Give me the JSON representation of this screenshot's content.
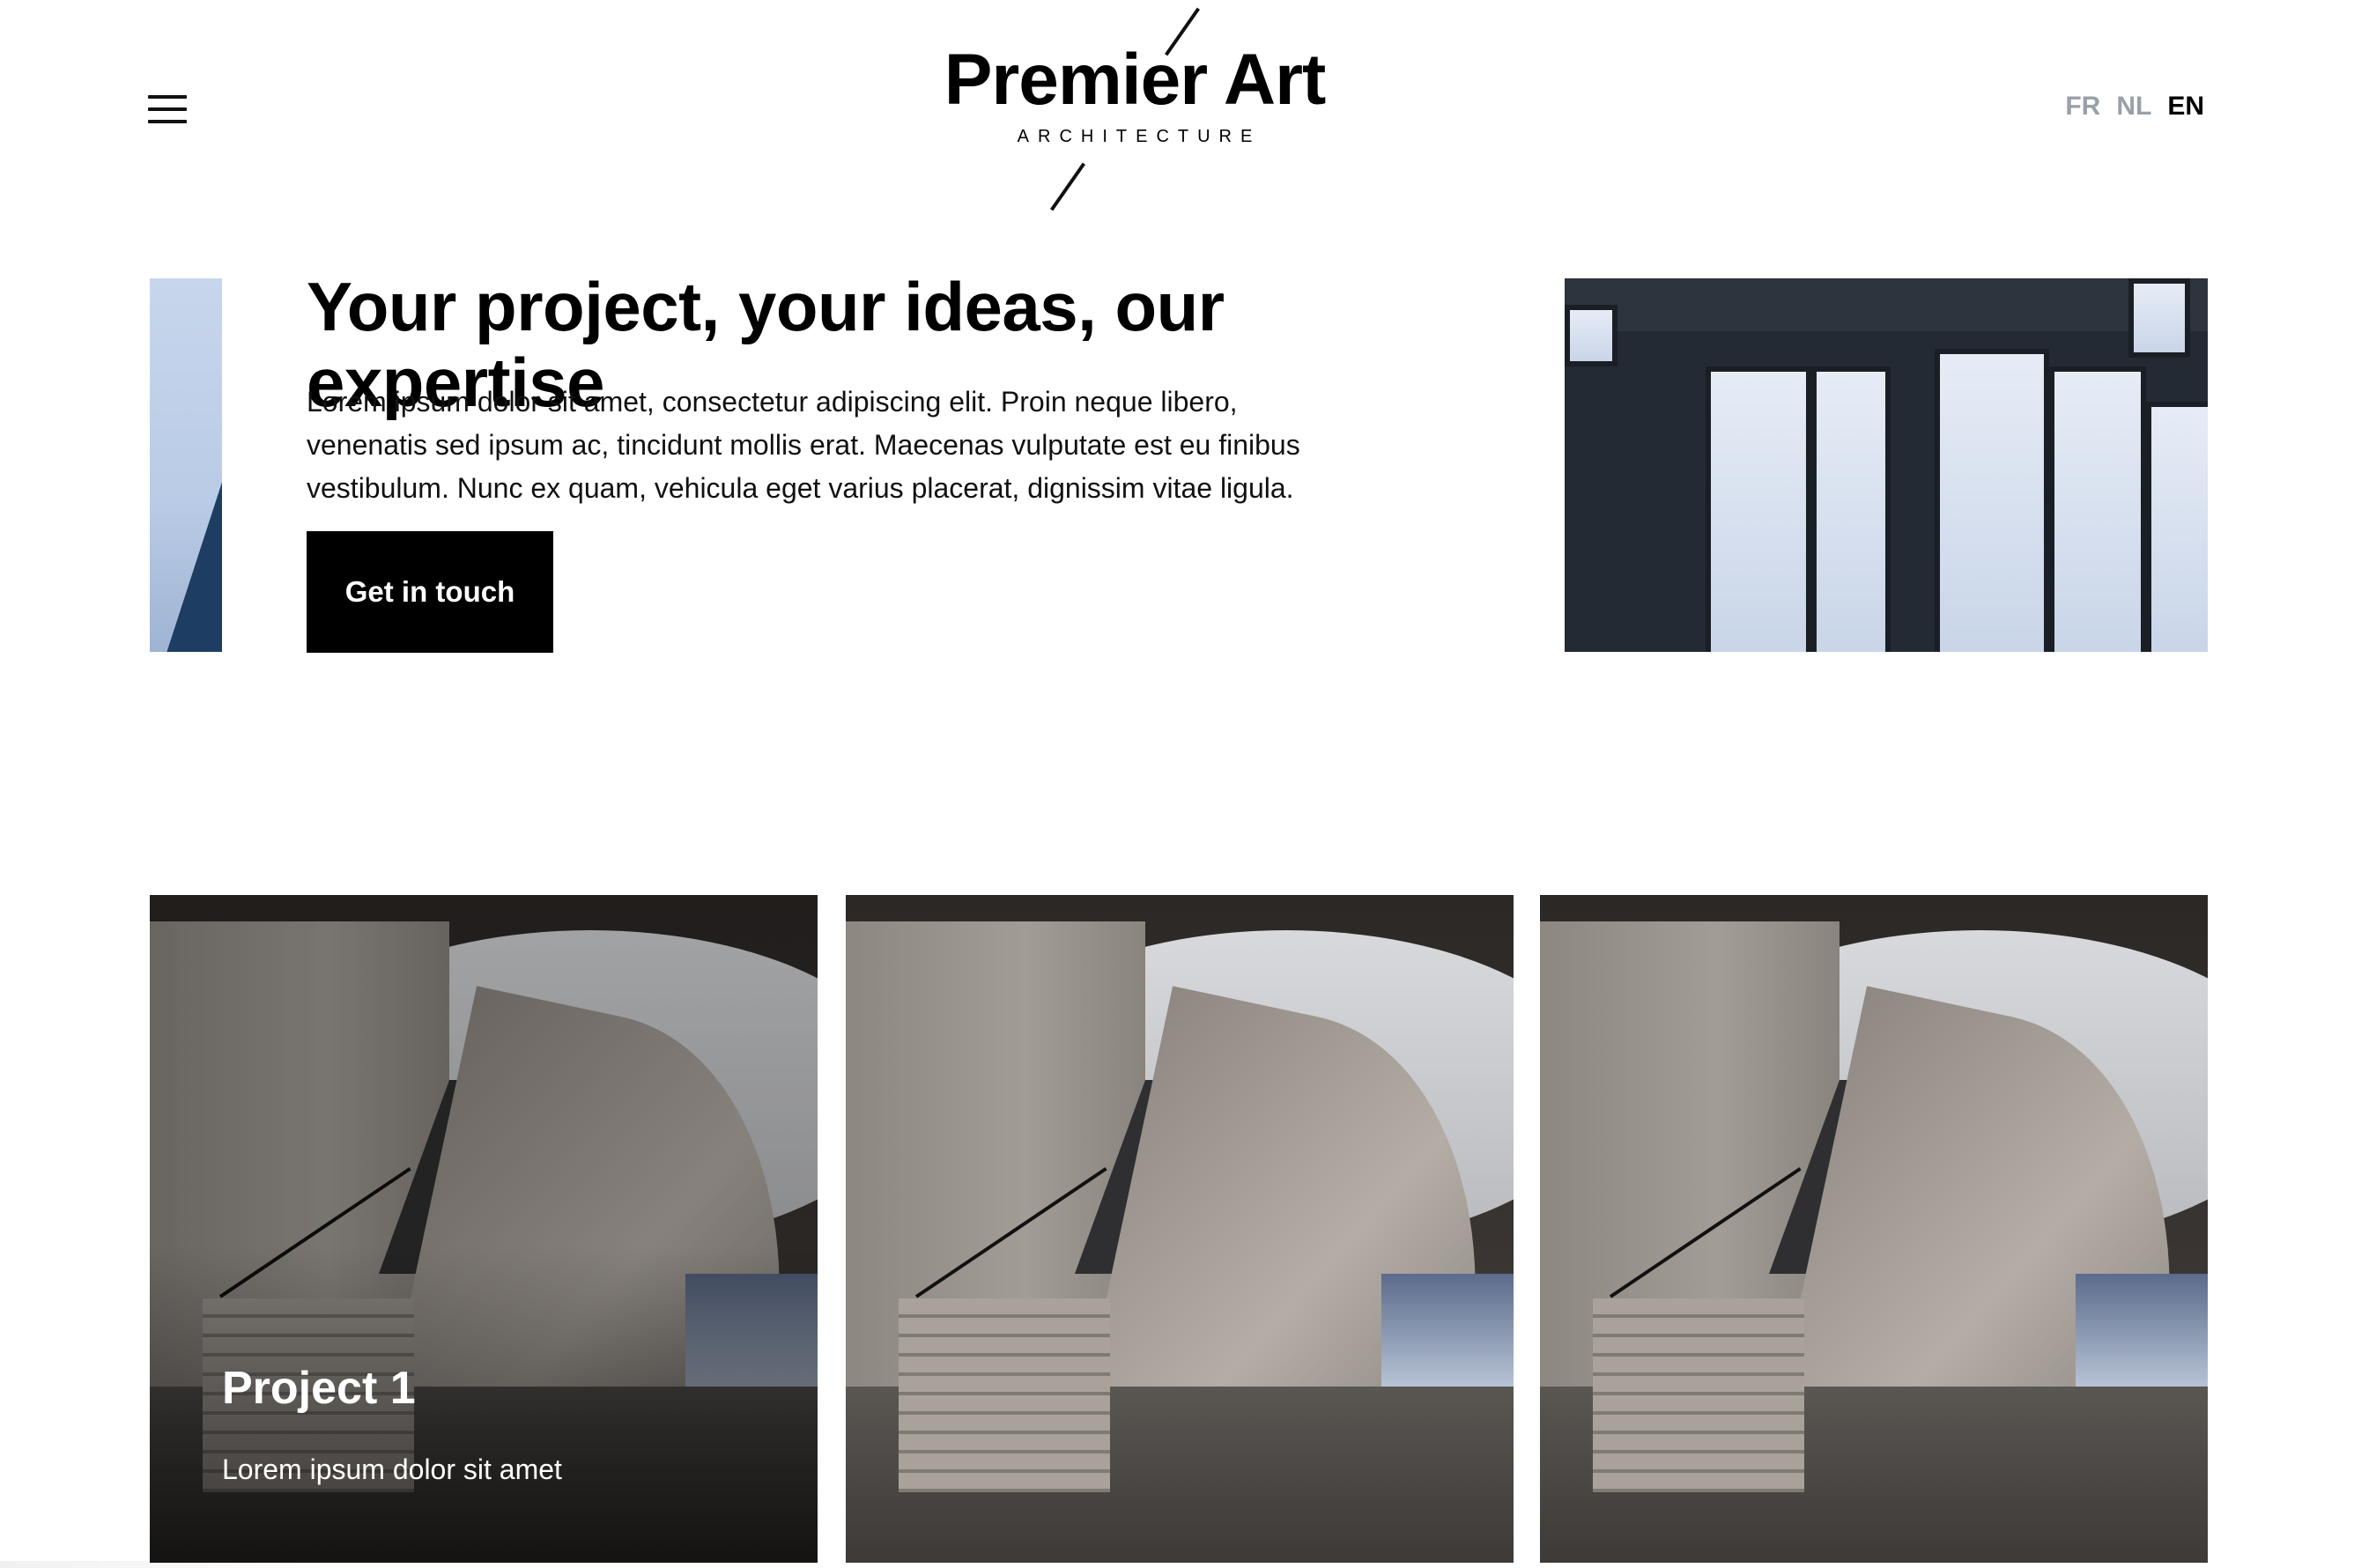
{
  "header": {
    "menu_icon": "hamburger-menu-icon",
    "logo": {
      "name": "Premier Art",
      "tagline": "ARCHITECTURE"
    },
    "languages": [
      {
        "code": "FR",
        "active": false
      },
      {
        "code": "NL",
        "active": false
      },
      {
        "code": "EN",
        "active": true
      }
    ]
  },
  "hero": {
    "title": "Your project, your ideas, our expertise",
    "text": "Lorem ipsum dolor sit amet, consectetur adipiscing elit. Proin neque libero, venenatis sed ipsum ac, tincidunt mollis erat. Maecenas vulputate est eu finibus vestibulum. Nunc ex quam, vehicula eget varius placerat, dignissim vitae ligula.",
    "cta_label": "Get in touch"
  },
  "projects": [
    {
      "title": "Project 1",
      "description": "Lorem ipsum dolor sit amet",
      "highlighted": true
    },
    {
      "title": "",
      "description": "",
      "highlighted": false
    },
    {
      "title": "",
      "description": "",
      "highlighted": false
    }
  ],
  "colors": {
    "text": "#000000",
    "lang_inactive": "#9aa0a8",
    "button_bg": "#000000",
    "button_text": "#ffffff"
  }
}
